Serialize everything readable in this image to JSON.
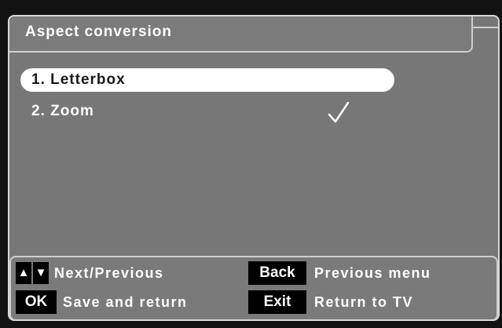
{
  "title": "Aspect conversion",
  "menu": {
    "items": [
      {
        "label": "1. Letterbox",
        "selected": true,
        "checked": false
      },
      {
        "label": "2. Zoom",
        "selected": false,
        "checked": true
      }
    ],
    "check_icon": "checkmark-icon"
  },
  "help": {
    "up_key": "▲",
    "down_key": "▼",
    "nav_label": "Next/Previous",
    "ok_key": "OK",
    "ok_label": "Save and return",
    "back_key": "Back",
    "back_label": "Previous menu",
    "exit_key": "Exit",
    "exit_label": "Return to TV"
  },
  "colors": {
    "panel": "#777777",
    "selected_item_bg": "#ffffff",
    "key_bg": "#000000",
    "text": "#ffffff"
  }
}
